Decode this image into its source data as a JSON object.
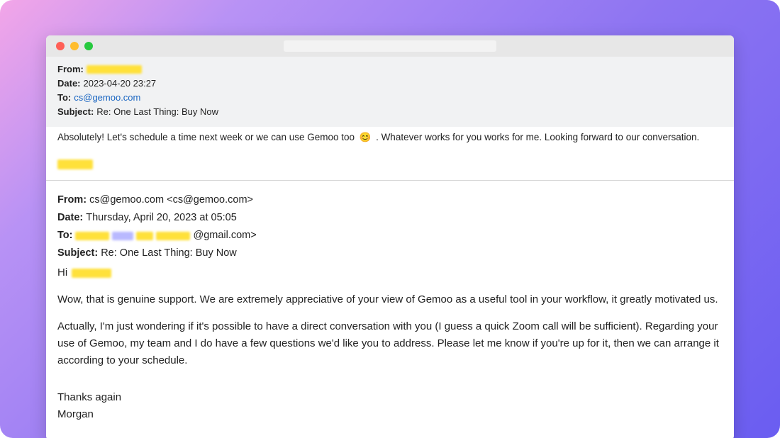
{
  "header": {
    "labels": {
      "from": "From:",
      "date": "Date:",
      "to": "To:",
      "subject": "Subject:"
    },
    "date_value": "2023-04-20 23:27",
    "to_value": "cs@gemoo.com",
    "subject_value": "Re: One Last Thing: Buy Now"
  },
  "reply": {
    "text_before_emoji": "Absolutely! Let's schedule a time next week or we can use Gemoo too",
    "emoji": "😊",
    "text_after_emoji": ". Whatever works for you works for me. Looking forward to our conversation."
  },
  "quoted": {
    "labels": {
      "from": "From:",
      "date": "Date:",
      "to": "To:",
      "subject": "Subject:"
    },
    "from_value": "cs@gemoo.com <cs@gemoo.com>",
    "date_value": "Thursday, April 20, 2023 at 05:05",
    "to_suffix": "@gmail.com>",
    "subject_value": "Re: One Last Thing: Buy Now",
    "greeting": "Hi",
    "para1": "Wow, that is genuine support. We are extremely appreciative of your view of Gemoo as a useful tool in your workflow, it greatly motivated us.",
    "para2": "Actually, I'm just wondering if it's possible to have a direct conversation with you (I guess a quick Zoom call will be sufficient). Regarding your use of Gemoo, my team and I do have a few questions we'd like you to address. Please let me know if you're up for it, then we can arrange it according to your schedule.",
    "signoff1": "Thanks again",
    "signoff2": "Morgan"
  }
}
